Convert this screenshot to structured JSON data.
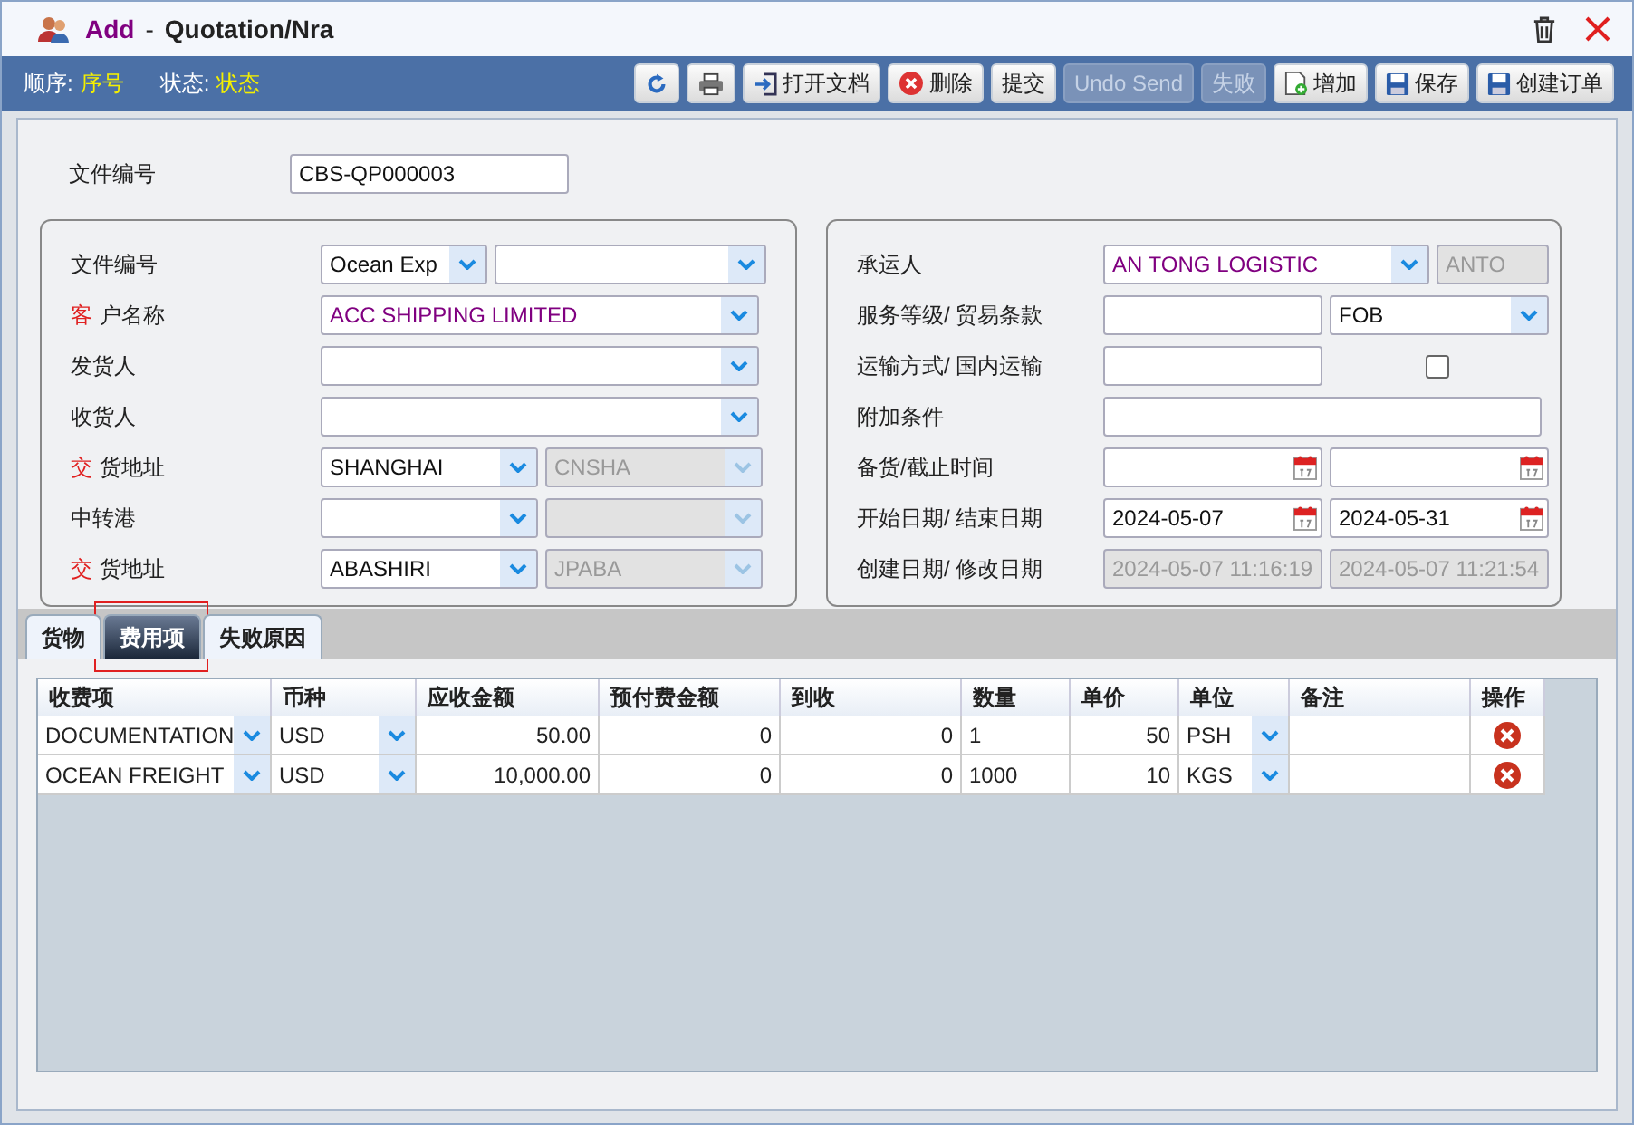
{
  "window": {
    "mode": "Add",
    "separator": "-",
    "title": "Quotation/Nra"
  },
  "status": [
    {
      "label": "顺序:",
      "value": "序号"
    },
    {
      "label": "状态:",
      "value": "状态"
    }
  ],
  "toolbar": [
    {
      "kind": "refresh",
      "disabled": false
    },
    {
      "kind": "print",
      "disabled": false
    },
    {
      "kind": "open",
      "label": "打开文档",
      "disabled": false
    },
    {
      "kind": "delete",
      "label": "删除",
      "disabled": false
    },
    {
      "kind": "text",
      "label": "提交",
      "disabled": false
    },
    {
      "kind": "text",
      "label": "Undo Send",
      "disabled": true
    },
    {
      "kind": "text",
      "label": "失败",
      "disabled": true
    },
    {
      "kind": "add",
      "label": "增加",
      "disabled": false
    },
    {
      "kind": "save",
      "label": "保存",
      "disabled": false
    },
    {
      "kind": "save",
      "label": "创建订单",
      "disabled": false
    }
  ],
  "doc_number": {
    "label": "文件编号",
    "value": "CBS-QP000003"
  },
  "left_panel": [
    {
      "label": "文件编号",
      "inputs": [
        {
          "kind": "select",
          "value": "Ocean Exp"
        },
        {
          "kind": "select"
        }
      ]
    },
    {
      "prefix": "客",
      "label": "户名称",
      "inputs": [
        {
          "kind": "select",
          "value": "ACC SHIPPING LIMITED",
          "accent": true
        }
      ]
    },
    {
      "label": "发货人",
      "inputs": [
        {
          "kind": "select"
        }
      ]
    },
    {
      "label": "收货人",
      "inputs": [
        {
          "kind": "select"
        }
      ]
    },
    {
      "prefix": "交",
      "label": "货地址",
      "inputs": [
        {
          "kind": "select",
          "value": "SHANGHAI"
        },
        {
          "kind": "select",
          "value": "CNSHA",
          "disabled": true
        }
      ]
    },
    {
      "label": "中转港",
      "inputs": [
        {
          "kind": "select"
        },
        {
          "kind": "select",
          "disabled": true
        }
      ]
    },
    {
      "prefix": "交",
      "label": "货地址",
      "inputs": [
        {
          "kind": "select",
          "value": "ABASHIRI"
        },
        {
          "kind": "select",
          "value": "JPABA",
          "disabled": true
        }
      ]
    }
  ],
  "right_panel": [
    {
      "label": "承运人",
      "inputs": [
        {
          "kind": "select",
          "value": "AN TONG LOGISTIC",
          "accent": true
        },
        {
          "kind": "text",
          "value": "ANTO",
          "disabled": true
        }
      ]
    },
    {
      "label": "服务等级/ 贸易条款",
      "inputs": [
        {
          "kind": "text"
        },
        {
          "kind": "select",
          "value": "FOB"
        }
      ]
    },
    {
      "label": "运输方式/  国内运输",
      "inputs": [
        {
          "kind": "text"
        },
        {
          "kind": "checkbox",
          "checked": false
        }
      ]
    },
    {
      "label": "附加条件",
      "inputs": [
        {
          "kind": "text"
        }
      ]
    },
    {
      "label": "备货/截止时间",
      "inputs": [
        {
          "kind": "date"
        },
        {
          "kind": "date"
        }
      ]
    },
    {
      "label": "开始日期/ 结束日期",
      "inputs": [
        {
          "kind": "date",
          "value": "2024-05-07"
        },
        {
          "kind": "date",
          "value": "2024-05-31"
        }
      ]
    },
    {
      "label": "创建日期/ 修改日期",
      "inputs": [
        {
          "kind": "text",
          "value": "2024-05-07 11:16:19",
          "disabled": true
        },
        {
          "kind": "text",
          "value": "2024-05-07 11:21:54",
          "disabled": true
        }
      ]
    }
  ],
  "tabs": [
    {
      "label": "货物",
      "selected": false,
      "highlighted": false
    },
    {
      "label": "费用项",
      "selected": true,
      "highlighted": true
    },
    {
      "label": "失败原因",
      "selected": false,
      "highlighted": false
    }
  ],
  "table": {
    "columns": [
      {
        "label": "收费项",
        "kind": "select"
      },
      {
        "label": "币种",
        "kind": "select"
      },
      {
        "label": "应收金额",
        "kind": "amount"
      },
      {
        "label": "预付费金额",
        "kind": "amount"
      },
      {
        "label": "到收",
        "kind": "amount"
      },
      {
        "label": "数量",
        "kind": "text"
      },
      {
        "label": "单价",
        "kind": "amount"
      },
      {
        "label": "单位",
        "kind": "select"
      },
      {
        "label": "备注",
        "kind": "text"
      },
      {
        "label": "操作",
        "kind": "action"
      }
    ],
    "rows": [
      [
        "DOCUMENTATION",
        "USD",
        "50.00",
        "0",
        "0",
        "1",
        "50",
        "PSH",
        null,
        null
      ],
      [
        "OCEAN FREIGHT",
        "USD",
        "10,000.00",
        "0",
        "0",
        "1000",
        "10",
        "KGS",
        null,
        null
      ]
    ]
  }
}
